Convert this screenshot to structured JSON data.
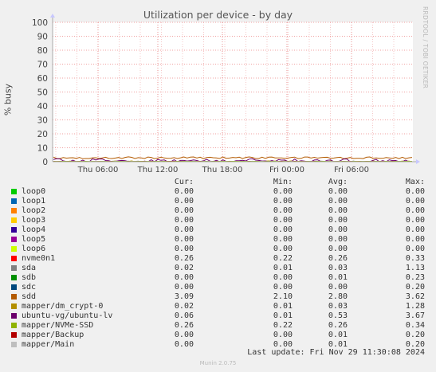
{
  "chart_data": {
    "type": "line",
    "title": "Utilization per device - by day",
    "ylabel": "% busy",
    "xlabel": "",
    "ylim": [
      0,
      100
    ],
    "y_ticks": [
      "0",
      "10",
      "20",
      "30",
      "40",
      "50",
      "60",
      "70",
      "80",
      "90",
      "100"
    ],
    "x_ticks": [
      "Thu 06:00",
      "Thu 12:00",
      "Thu 18:00",
      "Fri 00:00",
      "Fri 06:00"
    ],
    "grid": true,
    "watermark": "RRDTOOL / TOBI OETIKER",
    "legend_headers": [
      "Cur:",
      "Min:",
      "Avg:",
      "Max:"
    ],
    "series": [
      {
        "name": "loop0",
        "color": "#00cc00",
        "cur": "0.00",
        "min": "0.00",
        "avg": "0.00",
        "max": "0.00"
      },
      {
        "name": "loop1",
        "color": "#0066b3",
        "cur": "0.00",
        "min": "0.00",
        "avg": "0.00",
        "max": "0.00"
      },
      {
        "name": "loop2",
        "color": "#ff8000",
        "cur": "0.00",
        "min": "0.00",
        "avg": "0.00",
        "max": "0.00"
      },
      {
        "name": "loop3",
        "color": "#ffcc00",
        "cur": "0.00",
        "min": "0.00",
        "avg": "0.00",
        "max": "0.00"
      },
      {
        "name": "loop4",
        "color": "#330099",
        "cur": "0.00",
        "min": "0.00",
        "avg": "0.00",
        "max": "0.00"
      },
      {
        "name": "loop5",
        "color": "#990099",
        "cur": "0.00",
        "min": "0.00",
        "avg": "0.00",
        "max": "0.00"
      },
      {
        "name": "loop6",
        "color": "#ccff00",
        "cur": "0.00",
        "min": "0.00",
        "avg": "0.00",
        "max": "0.00"
      },
      {
        "name": "nvme0n1",
        "color": "#ff0000",
        "cur": "0.26",
        "min": "0.22",
        "avg": "0.26",
        "max": "0.33"
      },
      {
        "name": "sda",
        "color": "#808080",
        "cur": "0.02",
        "min": "0.01",
        "avg": "0.03",
        "max": "1.13"
      },
      {
        "name": "sdb",
        "color": "#008f00",
        "cur": "0.00",
        "min": "0.00",
        "avg": "0.01",
        "max": "0.23"
      },
      {
        "name": "sdc",
        "color": "#00487d",
        "cur": "0.00",
        "min": "0.00",
        "avg": "0.00",
        "max": "0.20"
      },
      {
        "name": "sdd",
        "color": "#b35a00",
        "cur": "3.09",
        "min": "2.10",
        "avg": "2.80",
        "max": "3.62"
      },
      {
        "name": "mapper/dm_crypt-0",
        "color": "#b38f00",
        "cur": "0.02",
        "min": "0.01",
        "avg": "0.03",
        "max": "1.28"
      },
      {
        "name": "ubuntu-vg/ubuntu-lv",
        "color": "#6b006b",
        "cur": "0.06",
        "min": "0.01",
        "avg": "0.53",
        "max": "3.67"
      },
      {
        "name": "mapper/NVMe-SSD",
        "color": "#8fb300",
        "cur": "0.26",
        "min": "0.22",
        "avg": "0.26",
        "max": "0.34"
      },
      {
        "name": "mapper/Backup",
        "color": "#b30000",
        "cur": "0.00",
        "min": "0.00",
        "avg": "0.01",
        "max": "0.20"
      },
      {
        "name": "mapper/Main",
        "color": "#bebebe",
        "cur": "0.00",
        "min": "0.00",
        "avg": "0.01",
        "max": "0.20"
      }
    ]
  },
  "footer": {
    "last_update": "Last update: Fri Nov 29 11:30:08 2024",
    "generator": "Munin 2.0.75"
  }
}
